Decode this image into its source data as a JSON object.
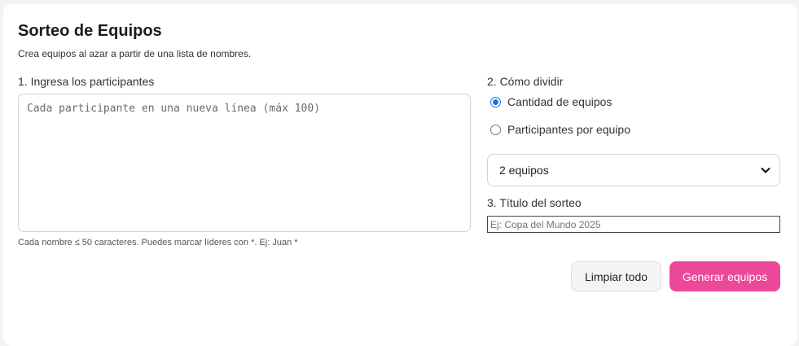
{
  "header": {
    "title": "Sorteo de Equipos",
    "subtitle": "Crea equipos al azar a partir de una lista de nombres."
  },
  "participants": {
    "label": "1. Ingresa los participantes",
    "placeholder": "Cada participante en una nueva línea (máx 100)",
    "hint": "Cada nombre ≤ 50 caracteres. Puedes marcar líderes con *. Ej: Juan *"
  },
  "divide": {
    "label": "2. Cómo dividir",
    "options": [
      {
        "label": "Cantidad de equipos",
        "checked": true
      },
      {
        "label": "Participantes por equipo",
        "checked": false
      }
    ],
    "select_value": "2 equipos"
  },
  "draw_title": {
    "label": "3. Título del sorteo",
    "placeholder": "Ej: Copa del Mundo 2025"
  },
  "actions": {
    "clear_label": "Limpiar todo",
    "generate_label": "Generar equipos"
  },
  "colors": {
    "accent": "#ec4899",
    "radio": "#1a73e8"
  },
  "icons": {
    "select_arrow": "chevron-down-icon"
  }
}
